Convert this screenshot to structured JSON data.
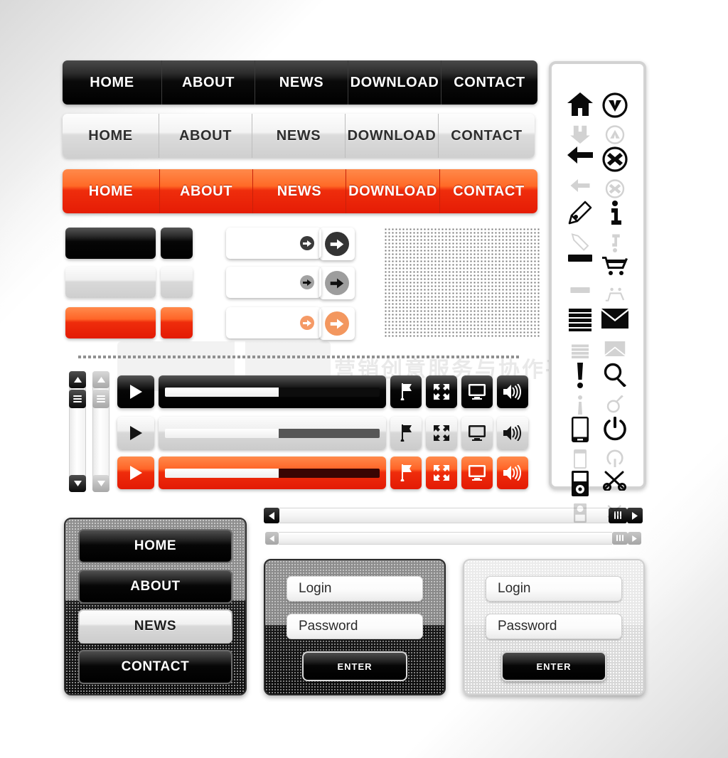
{
  "page": {
    "watermark": "营销创意服务与协作平台"
  },
  "navbars": [
    {
      "name": "dark",
      "items": [
        "HOME",
        "ABOUT",
        "NEWS",
        "DOWNLOAD",
        "CONTACT"
      ]
    },
    {
      "name": "light",
      "items": [
        "HOME",
        "ABOUT",
        "NEWS",
        "DOWNLOAD",
        "CONTACT"
      ]
    },
    {
      "name": "red",
      "items": [
        "HOME",
        "ABOUT",
        "NEWS",
        "DOWNLOAD",
        "CONTACT"
      ]
    }
  ],
  "buttons": {
    "arrow_icon": "arrow-right-icon",
    "rows": [
      "dark",
      "light",
      "red"
    ]
  },
  "players": {
    "play_icon": "play-icon",
    "icons": [
      "flag-icon",
      "fullscreen-icon",
      "monitor-icon",
      "volume-icon"
    ],
    "progress_percent": 53,
    "rows": [
      "dark",
      "light",
      "red"
    ]
  },
  "scrollbars": {
    "up_icon": "triangle-up-icon",
    "down_icon": "triangle-down-icon",
    "left_icon": "triangle-left-icon",
    "right_icon": "triangle-right-icon",
    "grip_icon": "grip-lines-icon"
  },
  "vertical_menu": {
    "items": [
      {
        "label": "HOME",
        "selected": false
      },
      {
        "label": "ABOUT",
        "selected": false
      },
      {
        "label": "NEWS",
        "selected": true
      },
      {
        "label": "CONTACT",
        "selected": false
      }
    ]
  },
  "login_forms": [
    {
      "theme": "dark",
      "login_placeholder": "Login",
      "password_placeholder": "Password",
      "submit_label": "ENTER"
    },
    {
      "theme": "light",
      "login_placeholder": "Login",
      "password_placeholder": "Password",
      "submit_label": "ENTER"
    }
  ],
  "icon_panel": {
    "icons": [
      "home-icon",
      "check-circle-icon",
      "arrow-left-icon",
      "close-circle-icon",
      "pencil-icon",
      "info-icon",
      "minus-icon",
      "shopping-cart-icon",
      "list-icon",
      "mail-icon",
      "exclamation-icon",
      "search-icon",
      "mobile-icon",
      "power-icon",
      "usb-drive-icon",
      "scissors-icon"
    ]
  },
  "colors": {
    "accent_red_top": "#ff8a4b",
    "accent_red_bottom": "#e31a04",
    "dark": "#000000",
    "light_grey": "#cfcfcf"
  }
}
